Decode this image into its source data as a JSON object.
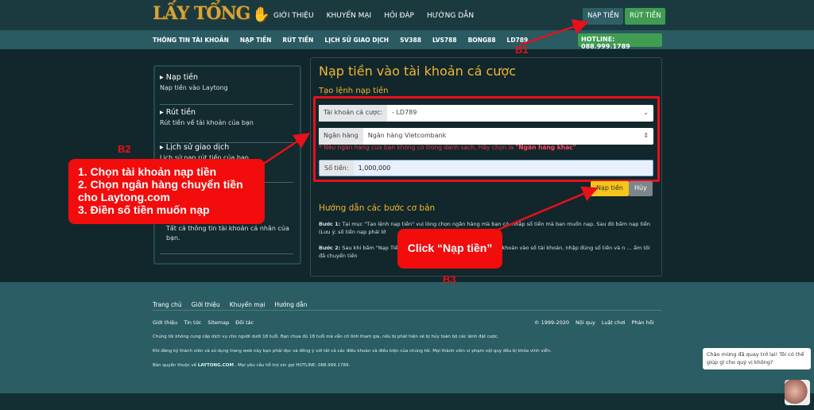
{
  "logo": "LẤY TỔNG",
  "header": {
    "nav": [
      "GIỚI THIỆU",
      "KHUYẾN MẠI",
      "HỎI ĐÁP",
      "HƯỚNG DẪN"
    ],
    "deposit": "NẠP TIỀN",
    "withdraw": "RÚT TIỀN"
  },
  "subnav": {
    "items": [
      "THÔNG TIN TÀI KHOẢN",
      "NẠP TIỀN",
      "RÚT TIỀN",
      "LỊCH SỬ GIAO DỊCH",
      "SV388",
      "LVS788",
      "BONG88",
      "LD789"
    ],
    "hotline": "HOTLINE: 088.999.1789"
  },
  "sidebar": [
    {
      "title": "Nạp tiền",
      "desc": "Nạp tiền vào Laytong"
    },
    {
      "title": "Rút tiền",
      "desc": "Rút tiền về tài khoản của bạn"
    },
    {
      "title": "Lịch sử giao dịch",
      "desc": "Lịch sử nạp rút tiền của bạn"
    },
    {
      "desc": "Tất cả thông tin tài khoản cá nhân của bạn."
    }
  ],
  "main": {
    "title": "Nạp tiền vào tài khoản cá cược",
    "subtitle": "Tạo lệnh nạp tiền",
    "account_label": "Tài khoản cá cược:",
    "account_value": "- LD789",
    "bank_label": "Ngân hàng",
    "bank_value": "Ngân hàng Vietcombank",
    "note": "* Nếu ngân hàng của bạn không có trong danh sách, Hãy chọn là ",
    "note_bold": "\"Ngân hàng khác\"",
    "amount_label": "Số tiền:",
    "amount_value": "1,000,000",
    "submit": "Nạp tiền",
    "cancel": "Hủy",
    "guide_title": "Hướng dẫn các bước cơ bản",
    "step1_label": "Bước 1:",
    "step1": " Tại mục \"Tạo lệnh nạp tiền\" vui lòng chọn ngân hàng mà bạn có, nhập số tiền mà bạn muốn nạp. Sau đó bấm nạp tiền (Lưu ý: số tiền nạp phải lớ",
    "step2_label": "Bước 2:",
    "step2": " Sau khi bấm \"Nạp Tiền\" … ản nhận tiền. bạn vui lòng chuyển khoản vào số tài khoản, nhập đúng số tiền và n … ấm tôi đã chuyển tiền"
  },
  "footer": {
    "links1": [
      "Trang chủ",
      "Giới thiệu",
      "Khuyến mại",
      "Hướng dẫn"
    ],
    "links2": [
      "Giới thiệu",
      "Tin tức",
      "Sitemap",
      "Đối tác"
    ],
    "copyright": "© 1999-2020",
    "links3": [
      "Nội quy",
      "Luật chơi",
      "Phản hồi"
    ],
    "line1": "Chúng tôi không cung cấp dịch vụ cho người dưới 18 tuổi. Bạn chưa đủ 18 tuổi mà vẫn cố tình tham gia, nếu bị phát hiện sẽ bị hủy toàn bộ các lệnh đặt cược.",
    "line2": "Khi đăng ký thành viên và sử dụng trang web này bạn phải đọc và đồng ý với tất cả các điều khoản và điều kiện của chúng tôi. Mọi thành viên vi phạm nội quy đều bị khóa vĩnh viễn.",
    "line3a": "Bản quyền thuộc về ",
    "line3b": "LAYTONG.COM",
    "line3c": " . Mọi yêu cầu hỗ trợ xin gọi HOTLINE: 088.999.1789."
  },
  "chat": "Chào mừng đã quay trở lại! Tôi có thể giúp gì cho quý vị không?",
  "annotations": {
    "b1": "B1",
    "b2": "B2",
    "b3": "B3",
    "callout1": [
      "1. Chọn tài khoản nạp tiền",
      "2. Chọn ngân hàng chuyển tiền",
      "cho Laytong.com",
      "3. Điền số tiền muốn nạp"
    ],
    "callout2": "Click “Nạp tiền”"
  },
  "colors": {
    "accent": "#f0b733",
    "annotation": "#f20c0c",
    "green": "#3f9c52"
  }
}
